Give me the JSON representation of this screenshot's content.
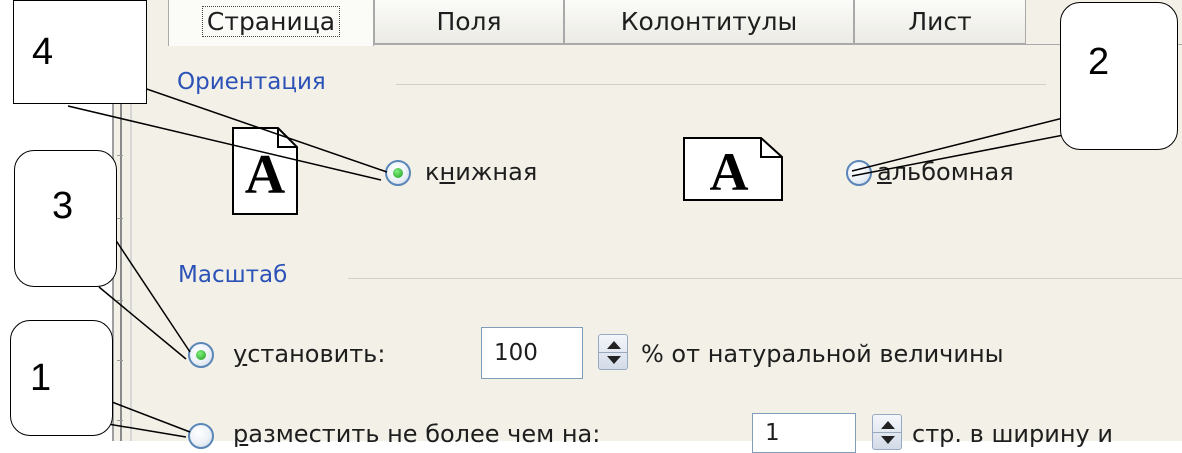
{
  "tabs": [
    "Страница",
    "Поля",
    "Колонтитулы",
    "Лист"
  ],
  "orientation": {
    "title": "Ориентация",
    "portrait": {
      "pre": "к",
      "accel": "н",
      "post": "ижная",
      "checked": true
    },
    "landscape": {
      "pre": "",
      "accel": "а",
      "post": "льбомная",
      "checked": false
    },
    "page_glyph": "A"
  },
  "scale": {
    "title": "Масштаб",
    "set": {
      "pre": "",
      "accel": "у",
      "post": "становить:",
      "value": "100",
      "suffix": "% от натуральной величины",
      "checked": true
    },
    "fit": {
      "pre": "",
      "accel": "р",
      "post": "азместить не более чем на:",
      "value": "1",
      "suffix": "стр. в ширину и",
      "checked": false
    }
  },
  "callouts": [
    "4",
    "3",
    "1",
    "2"
  ],
  "colors": {
    "accent": "#2c52b8",
    "radio_on": "#1e9b1e",
    "panel": "#f3f1e7"
  }
}
